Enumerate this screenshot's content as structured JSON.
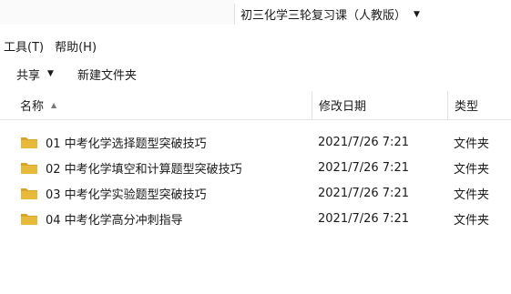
{
  "address_bar": {
    "path": "初三化学三轮复习课（人教版）"
  },
  "menu": [
    {
      "label": "工具(T)"
    },
    {
      "label": "帮助(H)"
    }
  ],
  "toolbar": {
    "share_label": "共享",
    "new_folder_label": "新建文件夹"
  },
  "columns": {
    "name": "名称",
    "date": "修改日期",
    "type": "类型"
  },
  "rows": [
    {
      "name": "01 中考化学选择题型突破技巧",
      "date": "2021/7/26 7:21",
      "type": "文件夹"
    },
    {
      "name": "02 中考化学填空和计算题型突破技巧",
      "date": "2021/7/26 7:21",
      "type": "文件夹"
    },
    {
      "name": "03 中考化学实验题型突破技巧",
      "date": "2021/7/26 7:21",
      "type": "文件夹"
    },
    {
      "name": "04 中考化学高分冲刺指导",
      "date": "2021/7/26 7:21",
      "type": "文件夹"
    }
  ],
  "colors": {
    "folder": "#e8b93a",
    "folder_dark": "#d9a42a"
  }
}
